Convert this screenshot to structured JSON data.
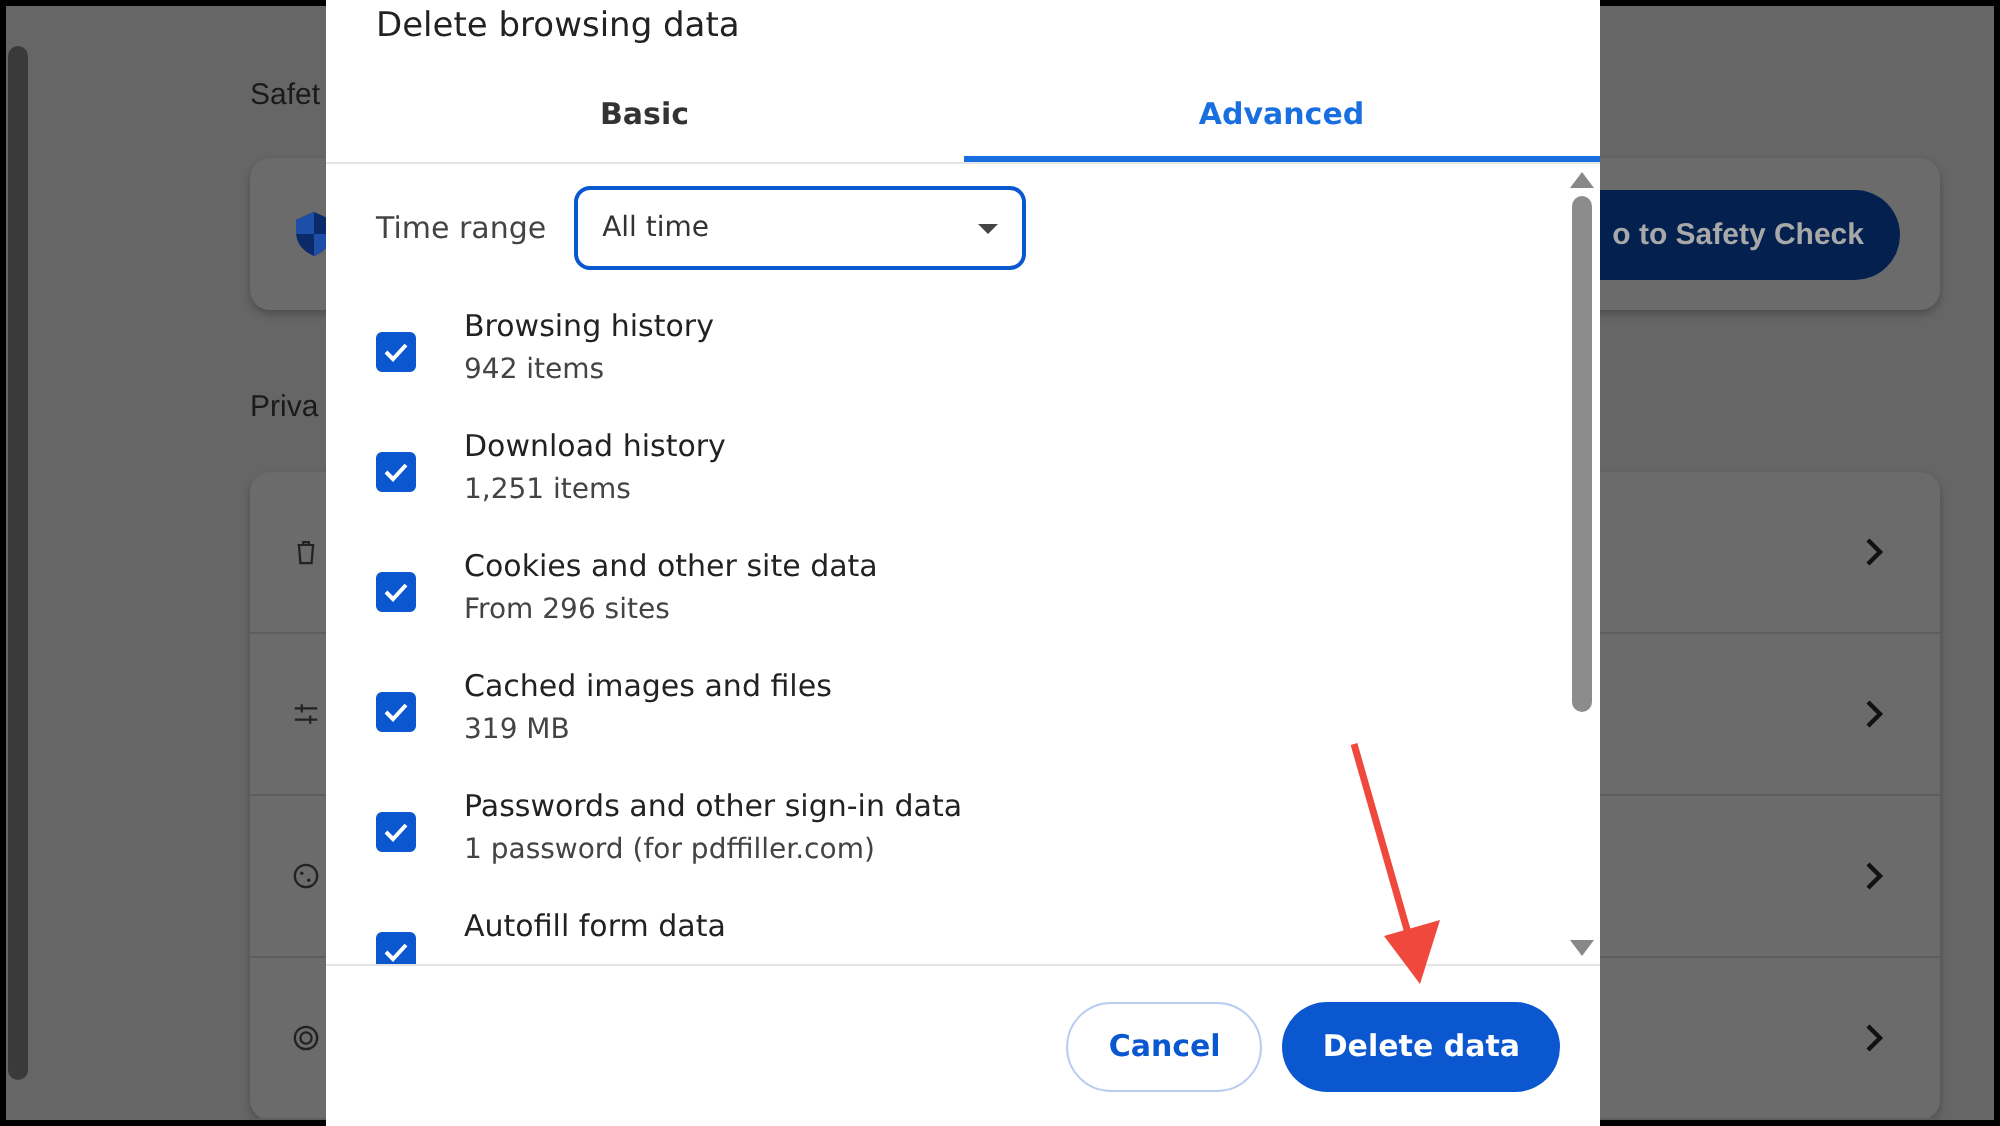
{
  "page": {
    "safety_heading": "Safet",
    "safety_button": "o to Safety Check",
    "privacy_heading": "Priva",
    "privacy_rows": [
      {
        "kind": "trash"
      },
      {
        "kind": "sliders"
      },
      {
        "kind": "cookie"
      },
      {
        "kind": "target"
      }
    ]
  },
  "dialog": {
    "title": "Delete browsing data",
    "tabs": [
      {
        "label": "Basic",
        "selected": false
      },
      {
        "label": "Advanced",
        "selected": true
      }
    ],
    "time_range": {
      "label": "Time range",
      "value": "All time"
    },
    "items": [
      {
        "label": "Browsing history",
        "detail": "942 items",
        "checked": true
      },
      {
        "label": "Download history",
        "detail": "1,251 items",
        "checked": true
      },
      {
        "label": "Cookies and other site data",
        "detail": "From 296 sites",
        "checked": true
      },
      {
        "label": "Cached images and files",
        "detail": "319 MB",
        "checked": true
      },
      {
        "label": "Passwords and other sign-in data",
        "detail": "1 password (for pdffiller.com)",
        "checked": true
      },
      {
        "label": "Autofill form data",
        "checked": true
      }
    ],
    "buttons": [
      {
        "label": "Cancel",
        "kind": "secondary"
      },
      {
        "label": "Delete data",
        "kind": "primary"
      }
    ]
  }
}
